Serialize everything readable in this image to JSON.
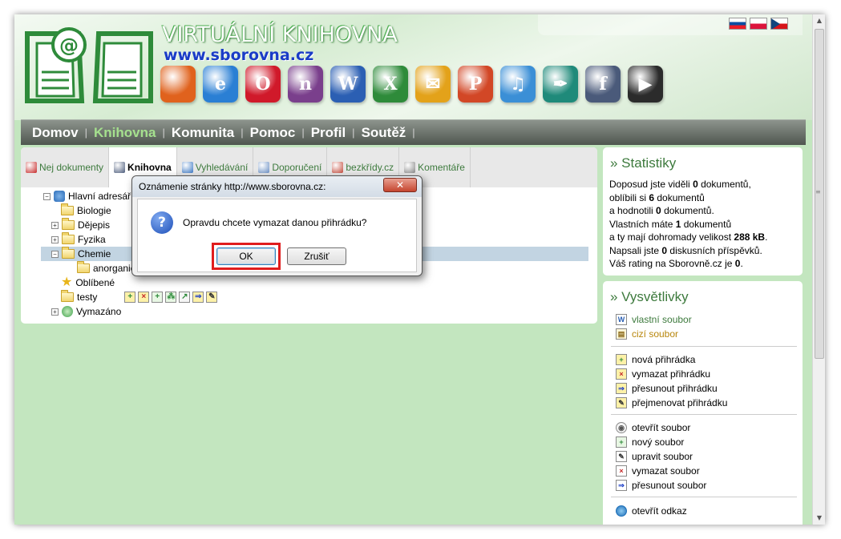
{
  "header": {
    "site_title": "VIRTUÁLNÍ KNIHOVNA",
    "site_url": "www.sborovna.cz",
    "flags": [
      "slovak-flag",
      "polish-flag",
      "czech-flag"
    ],
    "app_icons": [
      {
        "name": "firefox-icon",
        "glyph": "",
        "color": "#e0621d"
      },
      {
        "name": "internet-explorer-icon",
        "glyph": "e",
        "color": "#2a7fd4"
      },
      {
        "name": "opera-icon",
        "glyph": "O",
        "color": "#d0192a"
      },
      {
        "name": "onenote-icon",
        "glyph": "n",
        "color": "#7a3f8c"
      },
      {
        "name": "word-icon",
        "glyph": "W",
        "color": "#2b5fb3"
      },
      {
        "name": "excel-icon",
        "glyph": "X",
        "color": "#2e8b3a"
      },
      {
        "name": "outlook-icon",
        "glyph": "✉",
        "color": "#e3a21a"
      },
      {
        "name": "powerpoint-icon",
        "glyph": "P",
        "color": "#d24726"
      },
      {
        "name": "music-file-icon",
        "glyph": "♫",
        "color": "#3b8fd6"
      },
      {
        "name": "publisher-icon",
        "glyph": "✒",
        "color": "#1f8a7a"
      },
      {
        "name": "flash-icon",
        "glyph": "f",
        "color": "#4a5a7a"
      },
      {
        "name": "avi-video-icon",
        "glyph": "▶",
        "color": "#2b2b2b"
      }
    ]
  },
  "nav": {
    "items": [
      "Domov",
      "Knihovna",
      "Komunita",
      "Pomoc",
      "Profil",
      "Soutěž"
    ],
    "active_index": 1,
    "separator": "|"
  },
  "tabs": [
    {
      "label": "Nej dokumenty",
      "icon": "award-icon",
      "active": false
    },
    {
      "label": "Knihovna",
      "icon": "library-icon",
      "active": true
    },
    {
      "label": "Vyhledávání",
      "icon": "magnifier-icon",
      "active": false
    },
    {
      "label": "Doporučení",
      "icon": "envelope-icon",
      "active": false
    },
    {
      "label": "bezkřídy.cz",
      "icon": "home-icon",
      "active": false
    },
    {
      "label": "Komentáře",
      "icon": "comments-icon",
      "active": false
    }
  ],
  "tree": {
    "root": "Hlavní adresář",
    "items": [
      "Biologie",
      "Dějepis",
      "Fyzika",
      "Chemie",
      "anorganic",
      "Oblíbené",
      "testy",
      "Vymazáno"
    ],
    "selected": "testy"
  },
  "dialog": {
    "title": "Oznámenie stránky http://www.sborovna.cz:",
    "close_label": "✕",
    "message": "Opravdu chcete vymazat danou přihrádku?",
    "ok_label": "OK",
    "cancel_label": "Zrušiť"
  },
  "stats": {
    "title": "» Statistiky",
    "lines": [
      [
        "Doposud jste viděli ",
        "0",
        " dokumentů,"
      ],
      [
        "oblíbili si ",
        "6",
        " dokumentů"
      ],
      [
        "a hodnotili ",
        "0",
        " dokumentů."
      ],
      [
        "Vlastních máte ",
        "1",
        " dokumentů"
      ],
      [
        "a ty mají dohromady velikost ",
        "288 kB",
        "."
      ],
      [
        "Napsali jste ",
        "0",
        " diskusních příspěvků."
      ],
      [
        "Váš rating na Sborovně.cz je ",
        "0",
        "."
      ]
    ]
  },
  "legend": {
    "title": "» Vysvětlivky",
    "own_file": "vlastní soubor",
    "foreign_file": "cizí soubor",
    "folder_actions": [
      "nová přihrádka",
      "vymazat přihrádku",
      "přesunout přihrádku",
      "přejmenovat přihrádku"
    ],
    "file_actions": [
      "otevřít soubor",
      "nový soubor",
      "upravit soubor",
      "vymazat soubor",
      "přesunout soubor"
    ],
    "link_actions": [
      "otevřít odkaz"
    ]
  },
  "colors": {
    "page_bg": "#c3e6bf",
    "accent_green": "#3d7a3d",
    "active_nav": "#a5e08e",
    "highlight_red": "#e01d1d"
  }
}
